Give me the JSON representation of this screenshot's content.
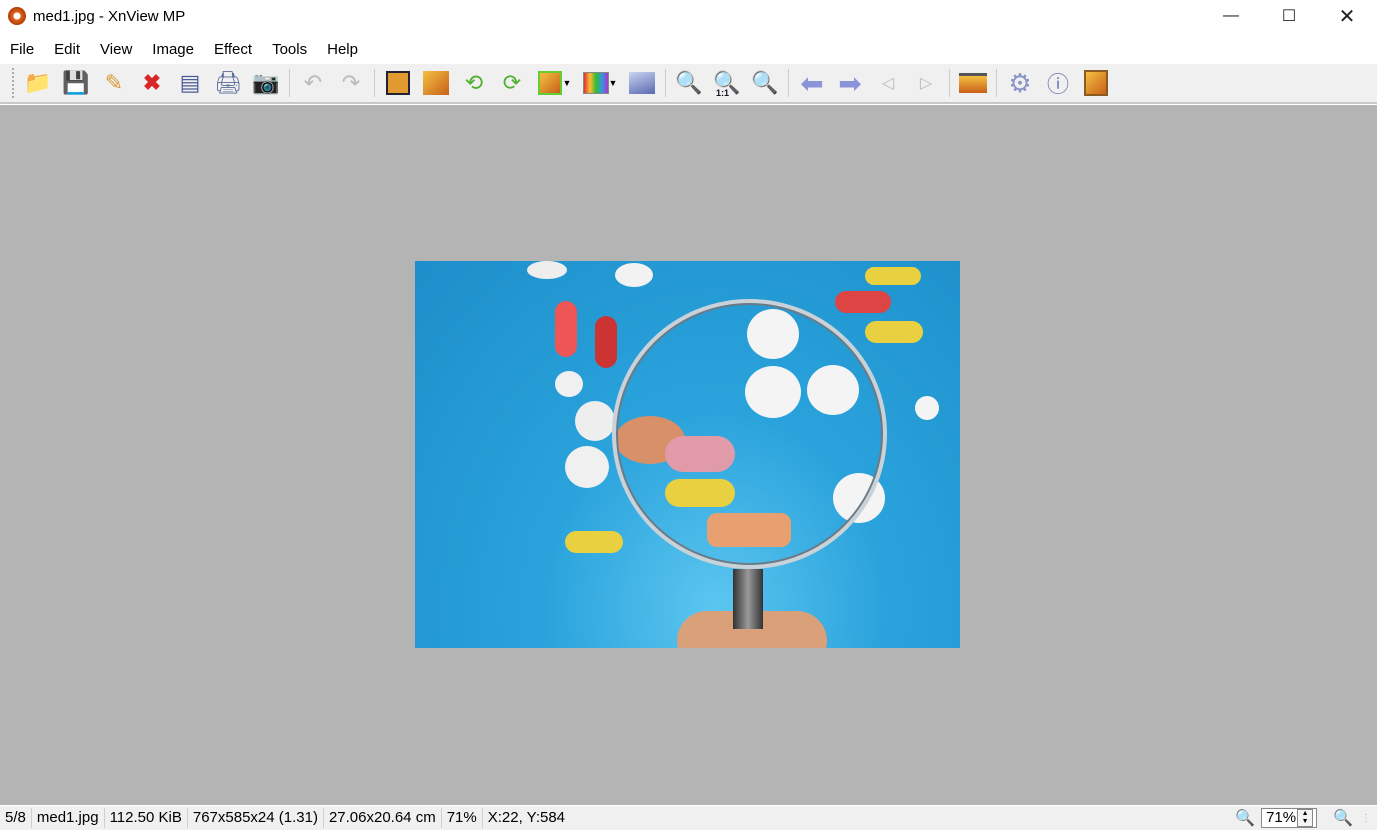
{
  "window": {
    "title": "med1.jpg - XnView MP"
  },
  "menu": [
    "File",
    "Edit",
    "View",
    "Image",
    "Effect",
    "Tools",
    "Help"
  ],
  "toolbar": {
    "icons": [
      "browser-icon",
      "save-icon",
      "edit-icon",
      "delete-icon",
      "scan-icon",
      "print-icon",
      "capture-icon",
      "undo-icon",
      "redo-icon",
      "crop-icon",
      "resize-icon",
      "rotate-left-icon",
      "rotate-right-icon",
      "transform-icon",
      "adjust-icon",
      "image-icon",
      "zoom-in-icon",
      "zoom-1to1-icon",
      "zoom-out-icon",
      "previous-icon",
      "next-icon",
      "first-icon",
      "last-icon",
      "slideshow-icon",
      "settings-icon",
      "info-icon",
      "paste-icon"
    ],
    "zoom_1to1_label": "1:1"
  },
  "status": {
    "index": "5/8",
    "filename": "med1.jpg",
    "filesize": "112.50 KiB",
    "dimensions": "767x585x24 (1.31)",
    "physical": "27.06x20.64 cm",
    "zoom": "71%",
    "cursor": "X:22, Y:584"
  },
  "zoom_control": {
    "value": "71%"
  }
}
